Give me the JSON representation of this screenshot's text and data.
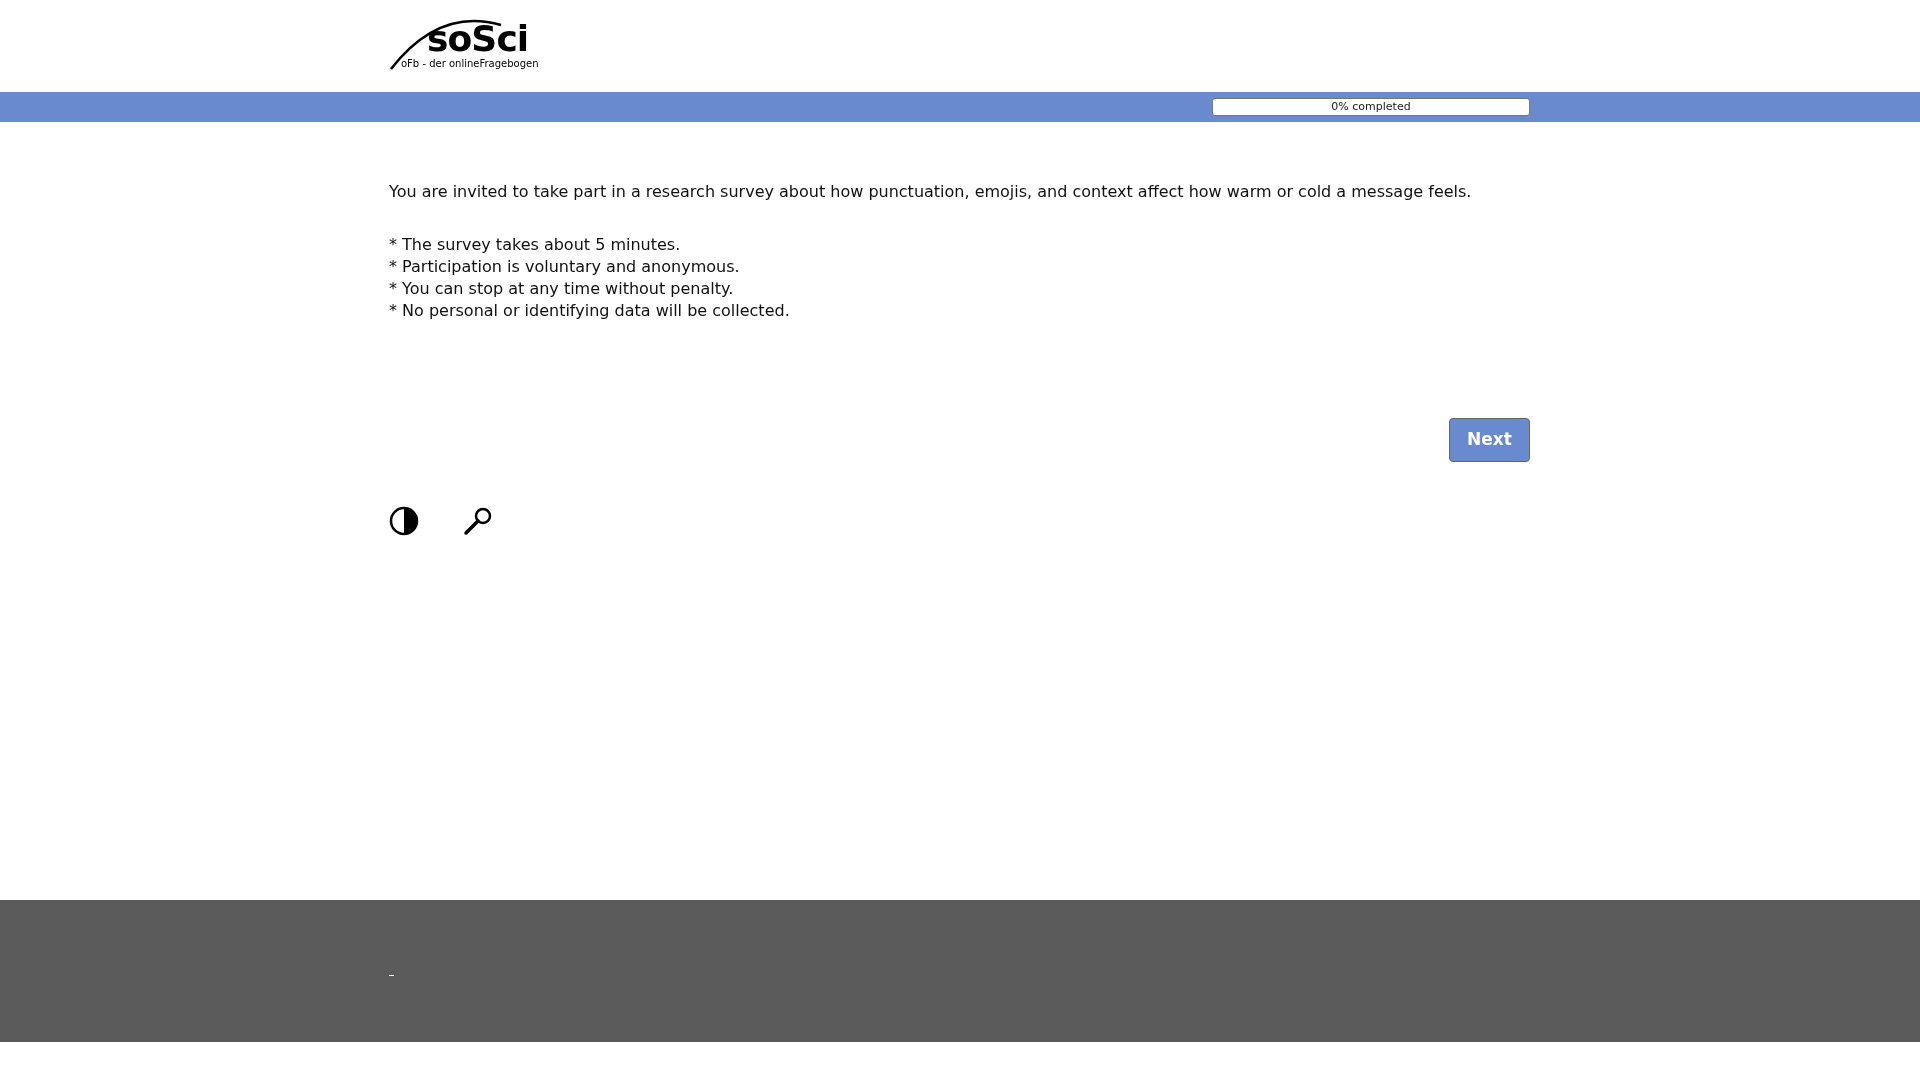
{
  "logo": {
    "title": "soSci",
    "subtitle": "oFb - der onlineFragebogen"
  },
  "progress": {
    "label": "0% completed"
  },
  "intro": "You are invited to take part in a research survey about how punctuation, emojis, and context affect how warm or cold a message feels.",
  "bullets": [
    "* The survey takes about 5 minutes.",
    "* Participation is voluntary and anonymous.",
    "* You can stop at any time without penalty.",
    "* No personal or identifying data will be collected."
  ],
  "next_button": "Next"
}
